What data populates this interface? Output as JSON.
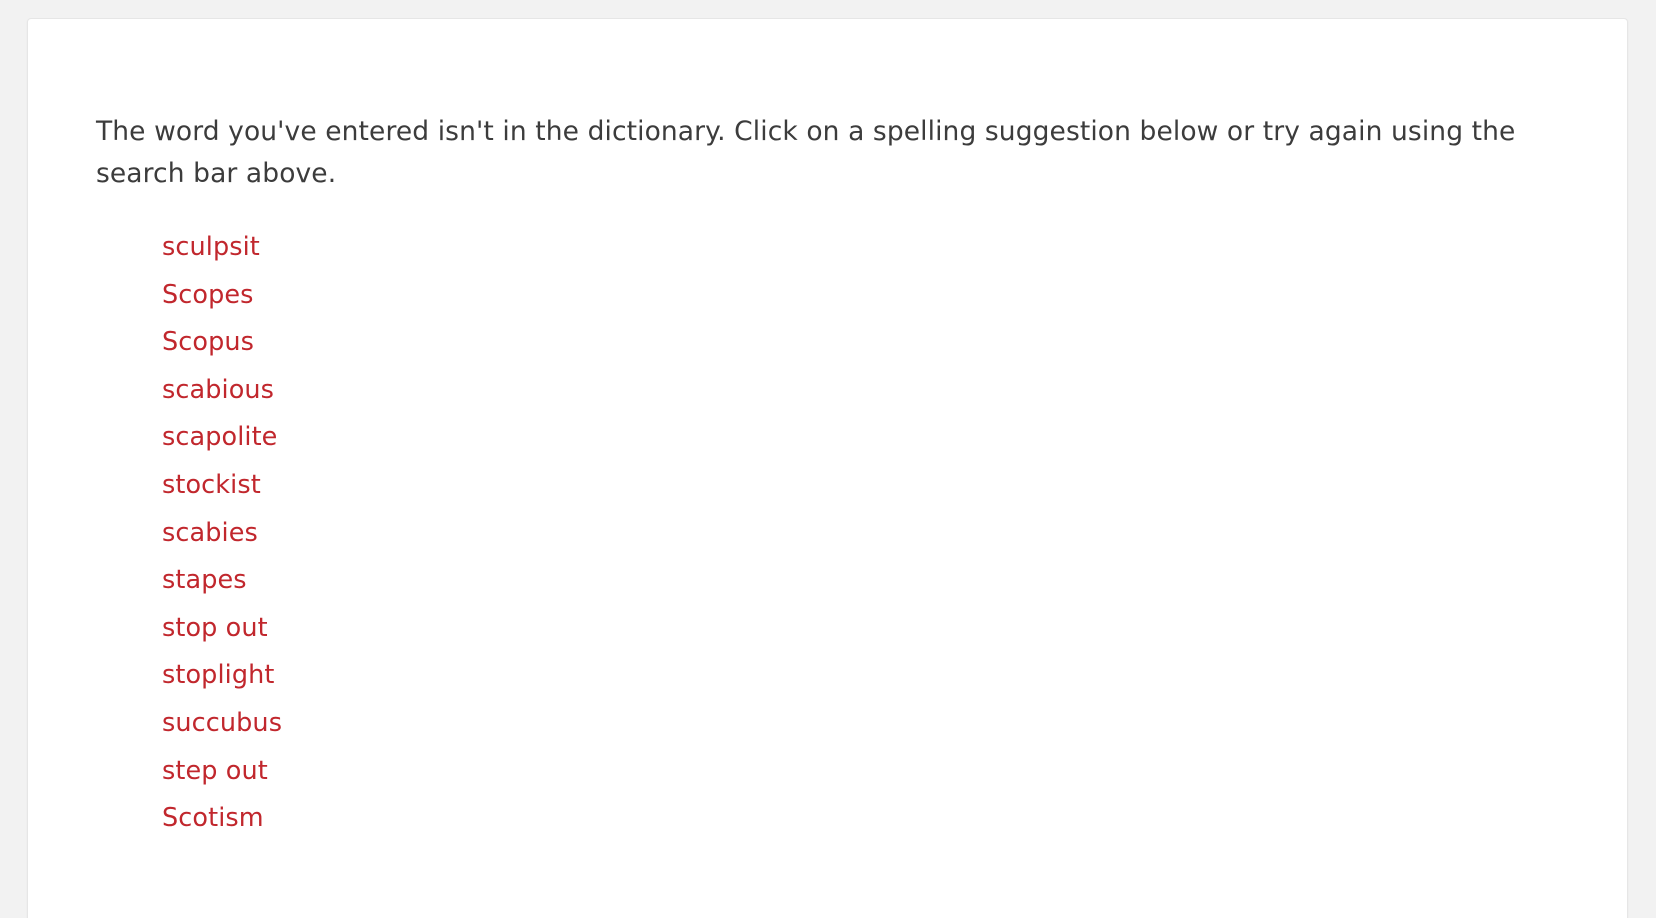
{
  "theme": {
    "page_background": "#f2f2f2",
    "card_background": "#ffffff",
    "card_border": "#e6e6e6",
    "body_text_color": "#3c3c3c",
    "link_accent_color": "#c1272d"
  },
  "notice": {
    "message": "The word you've entered isn't in the dictionary. Click on a spelling suggestion below or try again using the search bar above."
  },
  "suggestions": {
    "count": 13,
    "items": [
      {
        "word": "sculpsit"
      },
      {
        "word": "Scopes"
      },
      {
        "word": "Scopus"
      },
      {
        "word": "scabious"
      },
      {
        "word": "scapolite"
      },
      {
        "word": "stockist"
      },
      {
        "word": "scabies"
      },
      {
        "word": "stapes"
      },
      {
        "word": "stop out"
      },
      {
        "word": "stoplight"
      },
      {
        "word": "succubus"
      },
      {
        "word": "step out"
      },
      {
        "word": "Scotism"
      }
    ]
  }
}
